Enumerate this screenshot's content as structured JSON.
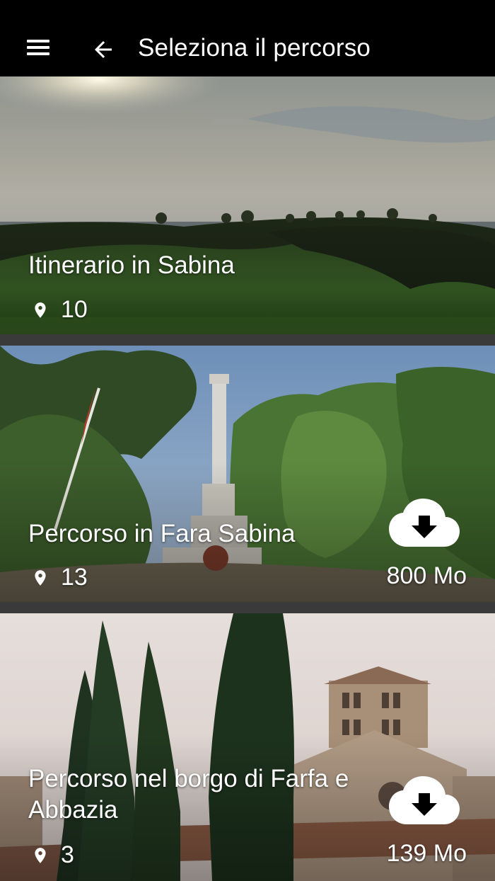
{
  "appbar": {
    "title": "Seleziona il percorso",
    "menu_icon": "hamburger-menu-icon",
    "back_icon": "arrow-back-icon"
  },
  "routes": [
    {
      "name": "Itinerario in Sabina",
      "points": "10",
      "size": ""
    },
    {
      "name": "Percorso in Fara Sabina",
      "points": "13",
      "size": "800 Mo"
    },
    {
      "name": "Percorso nel borgo di Farfa e Abbazia",
      "points": "3",
      "size": "139 Mo"
    }
  ],
  "icons": {
    "place": "map-marker-icon",
    "download": "cloud-download-icon"
  },
  "colors": {
    "appbar": "#000000",
    "separator": "#3a3a3a",
    "text": "#ffffff"
  }
}
